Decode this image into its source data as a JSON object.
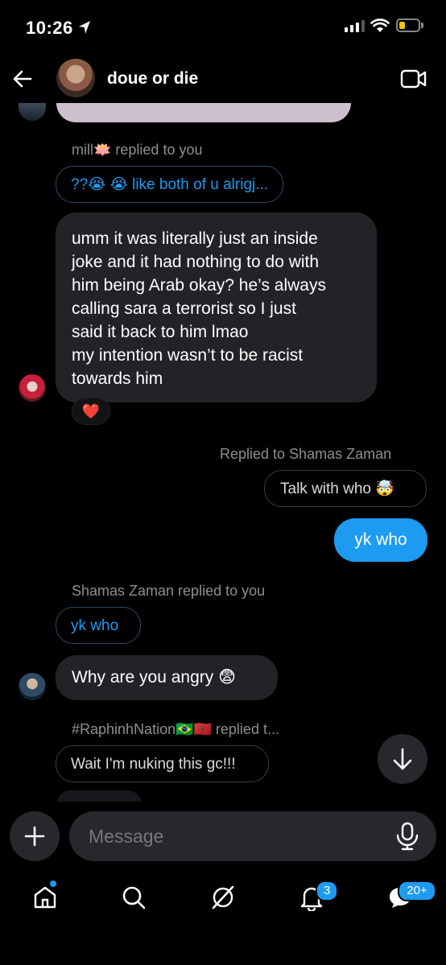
{
  "status_bar": {
    "time": "10:26"
  },
  "header": {
    "title": "doue or die"
  },
  "messages": {
    "reply1_meta": "mill🪷 replied to you",
    "reply1_quote": "??😭 😭 like both of u alrigj...",
    "msg1_lines": [
      "umm it was literally just an inside",
      "joke and it had nothing to do with",
      "him being Arab okay? he’s always",
      "calling sara a terrorist so I just",
      "said it back to him lmao",
      "my intention wasn’t to be racist",
      "towards him"
    ],
    "msg1_reaction": "❤️",
    "reply2_meta": "Replied to Shamas Zaman",
    "reply2_quote": "Talk with who 🤯",
    "msg2": "yk who",
    "reply3_meta": "Shamas Zaman replied to you",
    "reply3_quote": "yk who",
    "msg3": "Why are you angry 😨",
    "reply4_meta": "#RaphinhNation🇧🇷🇲🇦 replied t...",
    "reply4_quote": "Wait I'm nuking this gc!!!"
  },
  "composer": {
    "placeholder": "Message"
  },
  "tab_bar": {
    "notifications_badge": "3",
    "messages_badge": "20+"
  },
  "colors": {
    "accent": "#1d9bf0",
    "background": "#000000",
    "bubble_incoming": "#212327"
  }
}
